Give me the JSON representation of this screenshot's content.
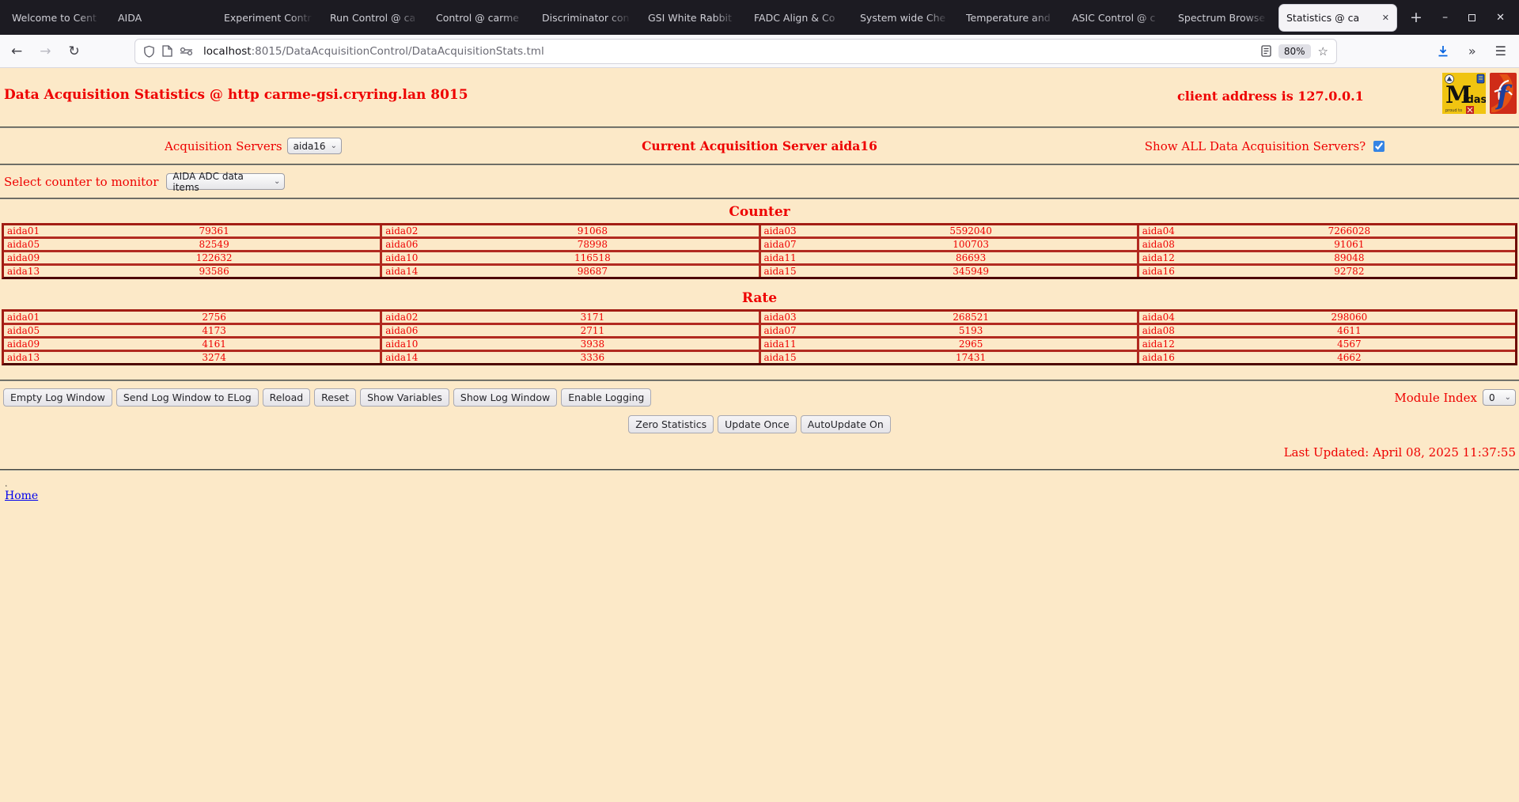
{
  "browser": {
    "tabs": [
      {
        "label": "Welcome to Cent"
      },
      {
        "label": "AIDA"
      },
      {
        "label": "Experiment Contr"
      },
      {
        "label": "Run Control @ ca"
      },
      {
        "label": "Control @ carme"
      },
      {
        "label": "Discriminator con"
      },
      {
        "label": "GSI White Rabbit"
      },
      {
        "label": "FADC Align & Co"
      },
      {
        "label": "System wide Che"
      },
      {
        "label": "Temperature and"
      },
      {
        "label": "ASIC Control @ c"
      },
      {
        "label": "Spectrum Browse"
      },
      {
        "label": "Statistics @ ca",
        "active": true
      }
    ],
    "url_host": "localhost",
    "url_rest": ":8015/DataAcquisitionControl/DataAcquisitionStats.tml",
    "zoom_badge": "80%",
    "icons": {
      "back-icon": "←",
      "forward-icon": "→",
      "reload-icon": "↻",
      "bookmark-star-icon": "☆",
      "overflow-chevrons-icon": "»",
      "menu-hamburger-icon": "☰",
      "new-tab-icon": "+",
      "tab-close-icon": "✕",
      "window-minimize-icon": "–",
      "window-close-icon": "✕",
      "select-chevron-icon": "⌄"
    }
  },
  "page": {
    "title": "Data Acquisition Statistics @ http carme-gsi.cryring.lan 8015",
    "client_address": "client address is 127.0.0.1",
    "servers_label": "Acquisition Servers",
    "server_selected": "aida16",
    "current_server": "Current Acquisition Server aida16",
    "show_all_label": "Show ALL Data Acquisition Servers?",
    "show_all_checked": true,
    "counter_select_label": "Select counter to monitor",
    "counter_select_value": "AIDA ADC data items",
    "counter_heading": "Counter",
    "rate_heading": "Rate",
    "log_buttons": [
      "Empty Log Window",
      "Send Log Window to ELog",
      "Reload",
      "Reset",
      "Show Variables",
      "Show Log Window",
      "Enable Logging"
    ],
    "module_index_label": "Module Index",
    "module_index_value": "0",
    "action_buttons": [
      "Zero Statistics",
      "Update Once",
      "AutoUpdate On"
    ],
    "last_updated": "Last Updated: April 08, 2025 11:37:55",
    "footer_dot": ".",
    "home_link": "Home",
    "logo_midas_text": "Midas"
  },
  "chart_data": [
    {
      "type": "table",
      "title": "Counter",
      "rows": [
        [
          [
            "aida01",
            "79361"
          ],
          [
            "aida02",
            "91068"
          ],
          [
            "aida03",
            "5592040"
          ],
          [
            "aida04",
            "7266028"
          ]
        ],
        [
          [
            "aida05",
            "82549"
          ],
          [
            "aida06",
            "78998"
          ],
          [
            "aida07",
            "100703"
          ],
          [
            "aida08",
            "91061"
          ]
        ],
        [
          [
            "aida09",
            "122632"
          ],
          [
            "aida10",
            "116518"
          ],
          [
            "aida11",
            "86693"
          ],
          [
            "aida12",
            "89048"
          ]
        ],
        [
          [
            "aida13",
            "93586"
          ],
          [
            "aida14",
            "98687"
          ],
          [
            "aida15",
            "345949"
          ],
          [
            "aida16",
            "92782"
          ]
        ]
      ]
    },
    {
      "type": "table",
      "title": "Rate",
      "rows": [
        [
          [
            "aida01",
            "2756"
          ],
          [
            "aida02",
            "3171"
          ],
          [
            "aida03",
            "268521"
          ],
          [
            "aida04",
            "298060"
          ]
        ],
        [
          [
            "aida05",
            "4173"
          ],
          [
            "aida06",
            "2711"
          ],
          [
            "aida07",
            "5193"
          ],
          [
            "aida08",
            "4611"
          ]
        ],
        [
          [
            "aida09",
            "4161"
          ],
          [
            "aida10",
            "3938"
          ],
          [
            "aida11",
            "2965"
          ],
          [
            "aida12",
            "4567"
          ]
        ],
        [
          [
            "aida13",
            "3274"
          ],
          [
            "aida14",
            "3336"
          ],
          [
            "aida15",
            "17431"
          ],
          [
            "aida16",
            "4662"
          ]
        ]
      ]
    }
  ],
  "colors": {
    "page_background": "#fce9c8",
    "text_red": "#ee0000",
    "table_border": "#b22a20",
    "accent_blue_checkbox": "#3584e4",
    "download_blue": "#0061e0",
    "tabbar_dark": "#1c1b22"
  }
}
